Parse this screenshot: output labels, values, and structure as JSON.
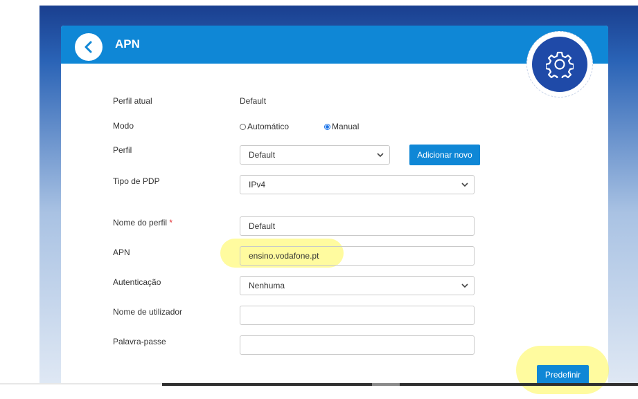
{
  "header": {
    "title": "APN"
  },
  "icons": {
    "back": "chevron-left-icon",
    "settings": "gear-icon",
    "dropdown": "chevron-down-icon"
  },
  "colors": {
    "header_blue": "#0f87d6",
    "gear_circle": "#1f4aa8",
    "button_blue": "#0f87d6",
    "highlight": "#fff750",
    "required": "#e0262b"
  },
  "form": {
    "current_profile": {
      "label": "Perfil atual",
      "value": "Default"
    },
    "mode": {
      "label": "Modo",
      "options": [
        {
          "label": "Automático",
          "selected": false
        },
        {
          "label": "Manual",
          "selected": true
        }
      ]
    },
    "profile": {
      "label": "Perfil",
      "selected": "Default",
      "add_new_label": "Adicionar novo"
    },
    "pdp_type": {
      "label": "Tipo de PDP",
      "selected": "IPv4"
    },
    "profile_name": {
      "label": "Nome do perfil",
      "required_mark": "*",
      "value": "Default"
    },
    "apn": {
      "label": "APN",
      "value": "ensino.vodafone.pt"
    },
    "authentication": {
      "label": "Autenticação",
      "selected": "Nenhuma"
    },
    "username": {
      "label": "Nome de utilizador",
      "value": ""
    },
    "password": {
      "label": "Palavra-passe",
      "value": ""
    },
    "reset_label": "Predefinir"
  }
}
